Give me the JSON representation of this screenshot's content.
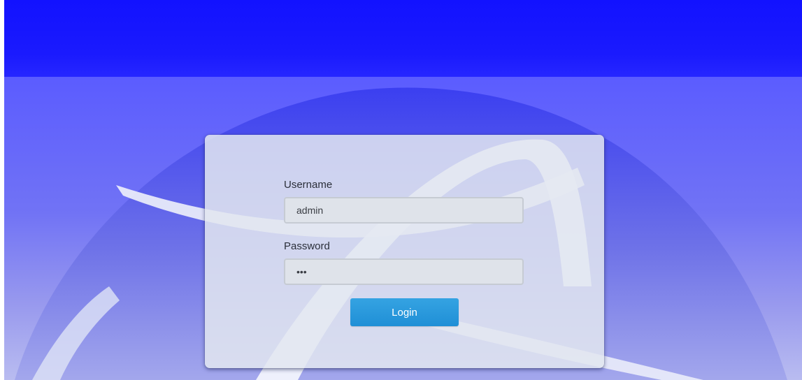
{
  "theme": {
    "header_color": "#1212ff",
    "hero_top_color": "#5b5cff",
    "hero_bottom_color": "#b9bcf0",
    "button_color": "#2a9be0"
  },
  "login": {
    "username_label": "Username",
    "username_value": "admin",
    "password_label": "Password",
    "password_value": "•••",
    "submit_label": "Login"
  }
}
